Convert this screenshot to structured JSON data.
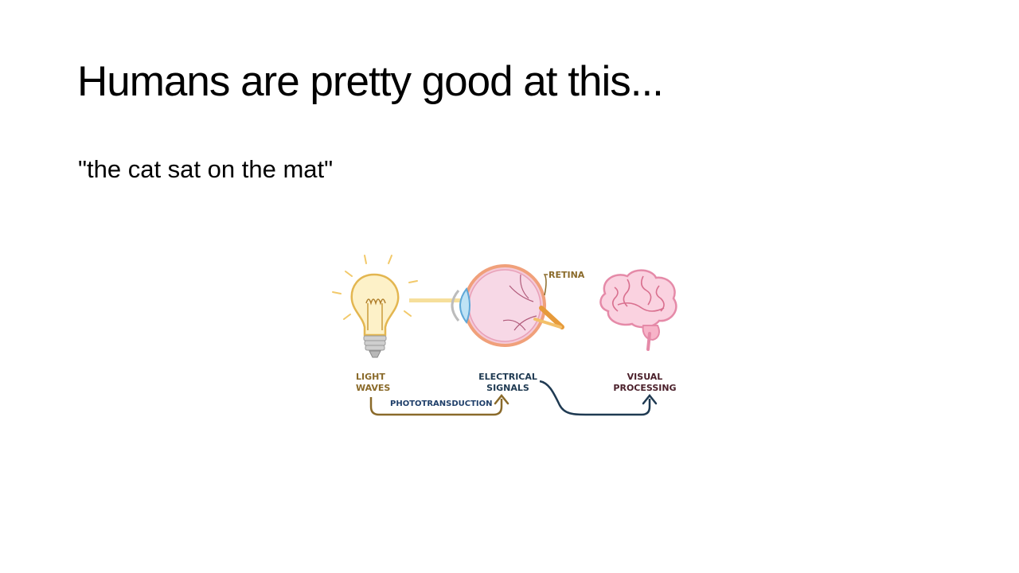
{
  "slide": {
    "title": "Humans are pretty good at this...",
    "body": "\"the cat sat on the mat\""
  },
  "diagram": {
    "retina_label": "RETINA",
    "light_label_line1": "LIGHT",
    "light_label_line2": "WAVES",
    "signals_label_line1": "ELECTRICAL",
    "signals_label_line2": "SIGNALS",
    "processing_label_line1": "VISUAL",
    "processing_label_line2": "PROCESSING",
    "transduction_label": "PHOTOTRANSDUCTION",
    "icons": [
      "light-bulb-icon",
      "eye-icon",
      "brain-icon"
    ],
    "colors": {
      "light": "#8a6a2a",
      "signals": "#1f3a52",
      "processing": "#4a1f2a",
      "transduction": "#1f3f6a",
      "bulb_glow": "#f5d98a",
      "brain": "#f2a2b8"
    }
  }
}
